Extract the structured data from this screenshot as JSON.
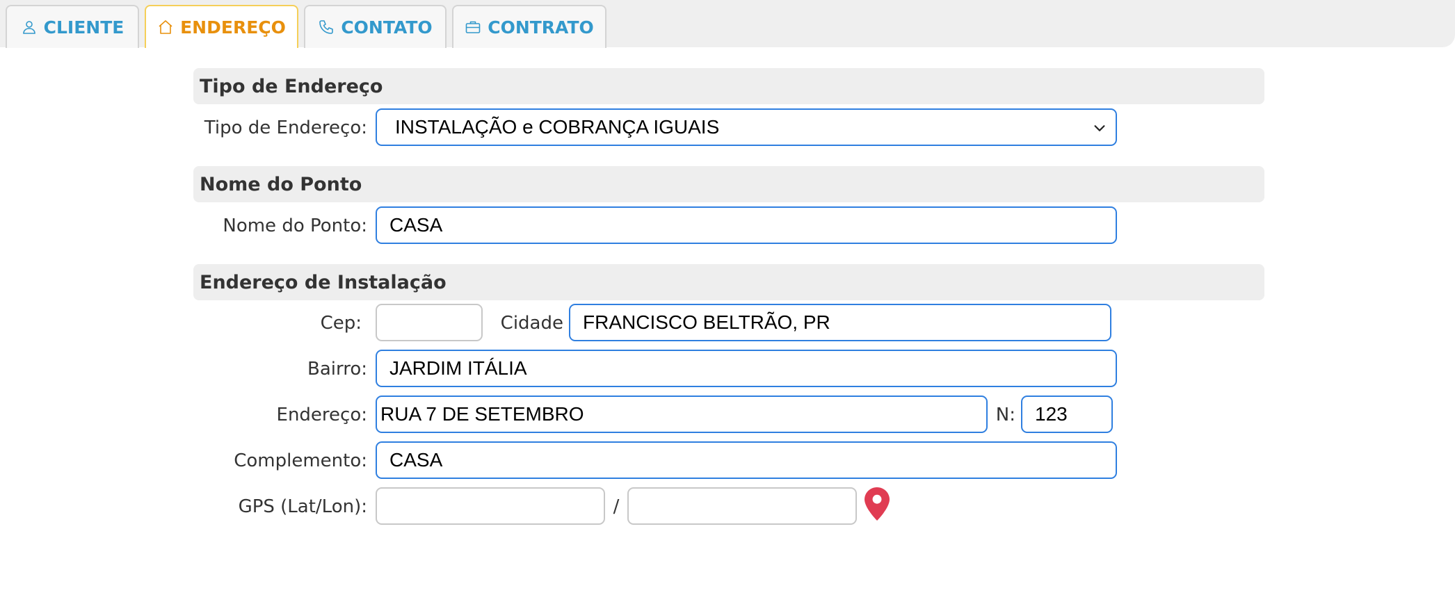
{
  "tabs": [
    {
      "label": "CLIENTE",
      "icon": "user-icon",
      "active": false
    },
    {
      "label": "ENDEREÇO",
      "icon": "home-icon",
      "active": true
    },
    {
      "label": "CONTATO",
      "icon": "phone-icon",
      "active": false
    },
    {
      "label": "CONTRATO",
      "icon": "briefcase-icon",
      "active": false
    }
  ],
  "colors": {
    "tab_text": "#3399cc",
    "tab_active_text": "#e8900d",
    "tab_active_border": "#f5cf58",
    "field_border": "#2f7fe0",
    "map_pin": "#e03c52"
  },
  "tipo_endereco": {
    "section_title": "Tipo de Endereço",
    "label": "Tipo de Endereço:",
    "value": "INSTALAÇÃO e COBRANÇA IGUAIS"
  },
  "nome_ponto": {
    "section_title": "Nome do Ponto",
    "label": "Nome do Ponto:",
    "value": "CASA"
  },
  "endereco_instalacao": {
    "section_title": "Endereço de Instalação",
    "cep_label": "Cep:",
    "cep_value": "",
    "cidade_label": "Cidade",
    "cidade_value": "FRANCISCO BELTRÃO, PR",
    "bairro_label": "Bairro:",
    "bairro_value": "JARDIM ITÁLIA",
    "endereco_label": "Endereço:",
    "endereco_value": "RUA 7 DE SETEMBRO",
    "numero_label": "N:",
    "numero_value": "123",
    "complemento_label": "Complemento:",
    "complemento_value": "CASA",
    "gps_label": "GPS (Lat/Lon):",
    "gps_separator": "/",
    "lat_value": "",
    "lon_value": "",
    "map_icon": "map-pin-icon"
  }
}
